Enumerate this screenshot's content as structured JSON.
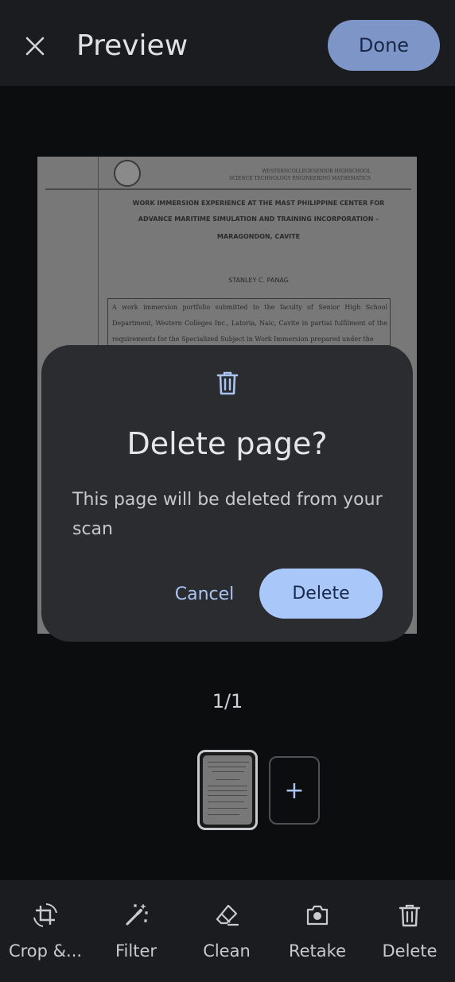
{
  "header": {
    "title": "Preview",
    "done_label": "Done"
  },
  "document": {
    "school_line1": "WESTERNCOLLEGESENIOR HIGHSCHOOL",
    "school_line2": "SCIENCE TECHNOLOGY ENGINEERING MATHEMATICS",
    "heading_lines": [
      "WORK IMMERSION EXPERIENCE AT THE MAST PHILIPPINE CENTER FOR",
      "ADVANCE MARITIME SIMULATION AND TRAINING INCORPORATION –",
      "MARAGONDON, CAVITE"
    ],
    "author": "STANLEY C. PANAG",
    "box_text": "A work immersion portfolio submitted to the faculty of Senior High School Department, Western Colleges Inc., Latoria, Naic, Cavite in partial fulfilment of the requirements for the Specialized Subject in Work Immersion prepared under the"
  },
  "dialog": {
    "icon": "trash-icon",
    "title": "Delete page?",
    "message": "This page will be deleted from your scan",
    "cancel_label": "Cancel",
    "delete_label": "Delete"
  },
  "pages": {
    "counter": "1/1",
    "add_symbol": "+"
  },
  "toolbar": {
    "items": [
      {
        "label": "Crop &...",
        "icon": "crop-rotate-icon"
      },
      {
        "label": "Filter",
        "icon": "magic-wand-icon"
      },
      {
        "label": "Clean",
        "icon": "eraser-icon"
      },
      {
        "label": "Retake",
        "icon": "camera-icon"
      },
      {
        "label": "Delete",
        "icon": "trash-icon"
      }
    ]
  },
  "colors": {
    "accent": "#aac7fa",
    "done_button_dimmed": "#7e96c7",
    "dialog_bg": "#2b2c30",
    "app_bg": "#0c0d0f"
  }
}
